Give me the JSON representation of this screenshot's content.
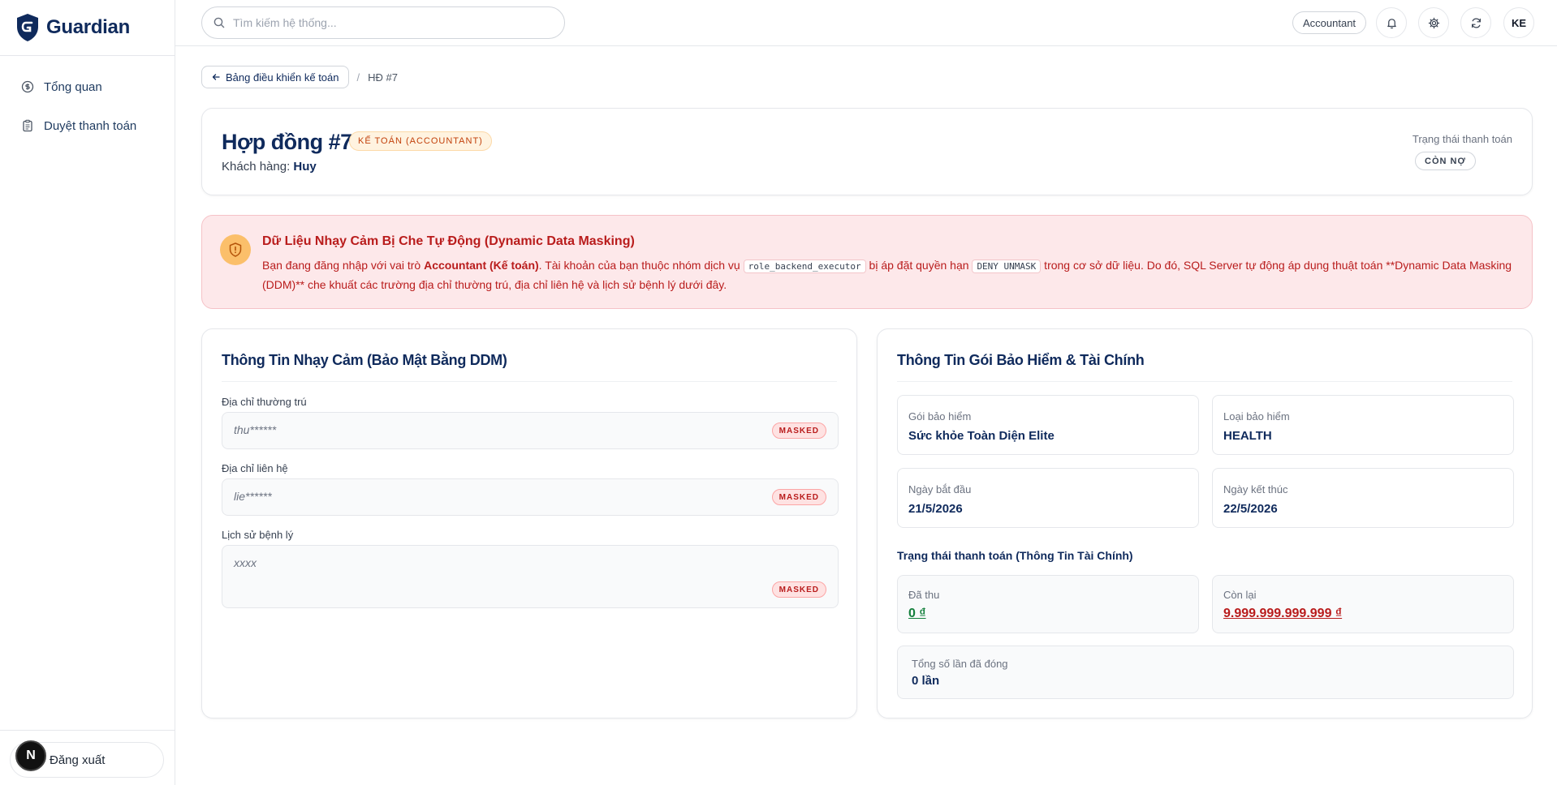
{
  "app": {
    "brand": "Guardian"
  },
  "sidebar": {
    "items": [
      {
        "label": "Tổng quan",
        "icon": "dollar-circle-icon"
      },
      {
        "label": "Duyệt thanh toán",
        "icon": "clipboard-icon"
      }
    ],
    "logout_label": "Đăng xuất",
    "avatar_letter": "N"
  },
  "header": {
    "search_placeholder": "Tìm kiếm hệ thống...",
    "role": "Accountant",
    "avatar_initials": "KE"
  },
  "breadcrumb": {
    "back_label": "Bảng điều khiển kế toán",
    "separator": "/",
    "current": "HĐ #7"
  },
  "contract": {
    "title": "Hợp đồng #7",
    "role_badge": "KẾ TOÁN (ACCOUNTANT)",
    "customer_label": "Khách hàng:",
    "customer_name": "Huy",
    "payment_status_label": "Trạng thái thanh toán",
    "payment_status": "CÒN NỢ"
  },
  "alert": {
    "title": "Dữ Liệu Nhạy Cảm Bị Che Tự Động (Dynamic Data Masking)",
    "p1": "Bạn đang đăng nhập với vai trò ",
    "role_strong": "Accountant (Kế toán)",
    "p2": ". Tài khoản của bạn thuộc nhóm dịch vụ ",
    "code1": "role_backend_executor",
    "p3": " bị áp đặt quyền hạn ",
    "code2": "DENY UNMASK",
    "p4": " trong cơ sở dữ liệu. Do đó, SQL Server tự động áp dụng thuật toán **Dynamic Data Masking (DDM)** che khuất các trường địa chỉ thường trú, địa chỉ liên hệ và lịch sử bệnh lý dưới đây."
  },
  "sensitive": {
    "title": "Thông Tin Nhạy Cảm (Bảo Mật Bằng DDM)",
    "fields": [
      {
        "label": "Địa chỉ thường trú",
        "value": "thu******",
        "badge": "MASKED"
      },
      {
        "label": "Địa chỉ liên hệ",
        "value": "lie******",
        "badge": "MASKED"
      },
      {
        "label": "Lịch sử bệnh lý",
        "value": "xxxx",
        "badge": "MASKED"
      }
    ]
  },
  "insurance": {
    "title": "Thông Tin Gói Bảo Hiểm & Tài Chính",
    "package_label": "Gói bảo hiểm",
    "package_value": "Sức khỏe Toàn Diện Elite",
    "type_label": "Loại bảo hiểm",
    "type_value": "HEALTH",
    "start_label": "Ngày bắt đầu",
    "start_value": "21/5/2026",
    "end_label": "Ngày kết thúc",
    "end_value": "22/5/2026",
    "finance_title": "Trạng thái thanh toán (Thông Tin Tài Chính)",
    "paid_label": "Đã thu",
    "paid_value": "0 ₫",
    "remaining_label": "Còn lại",
    "remaining_value": "9.999.999.999.999 ₫",
    "count_label": "Tổng số lần đã đóng",
    "count_value": "0 lần"
  }
}
